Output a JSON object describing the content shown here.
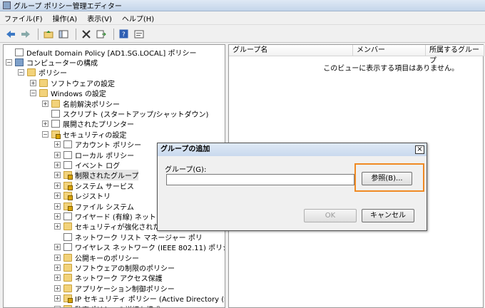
{
  "window": {
    "title": "グループ ポリシー管理エディター"
  },
  "menu": [
    "ファイル(F)",
    "操作(A)",
    "表示(V)",
    "ヘルプ(H)"
  ],
  "tree": [
    {
      "label": "Default Domain Policy [AD1.SG.LOCAL] ポリシー",
      "icon": "doc",
      "level": 0,
      "exp": ""
    },
    {
      "label": "コンピューターの構成",
      "icon": "pc",
      "level": 0,
      "exp": "−"
    },
    {
      "label": "ポリシー",
      "icon": "folder",
      "level": 1,
      "exp": "−"
    },
    {
      "label": "ソフトウェアの設定",
      "icon": "folder",
      "level": 2,
      "exp": "+"
    },
    {
      "label": "Windows の設定",
      "icon": "folder",
      "level": 2,
      "exp": "−"
    },
    {
      "label": "名前解決ポリシー",
      "icon": "folder",
      "level": 3,
      "exp": "+"
    },
    {
      "label": "スクリプト (スタートアップ/シャットダウン)",
      "icon": "doc",
      "level": 3,
      "exp": ""
    },
    {
      "label": "展開されたプリンター",
      "icon": "doc",
      "level": 3,
      "exp": "+"
    },
    {
      "label": "セキュリティの設定",
      "icon": "lock",
      "level": 3,
      "exp": "−"
    },
    {
      "label": "アカウント ポリシー",
      "icon": "doc",
      "level": 4,
      "exp": "+"
    },
    {
      "label": "ローカル ポリシー",
      "icon": "doc",
      "level": 4,
      "exp": "+"
    },
    {
      "label": "イベント ログ",
      "icon": "doc",
      "level": 4,
      "exp": "+"
    },
    {
      "label": "制限されたグループ",
      "icon": "lock",
      "level": 4,
      "exp": "+",
      "selected": true
    },
    {
      "label": "システム サービス",
      "icon": "lock",
      "level": 4,
      "exp": "+"
    },
    {
      "label": "レジストリ",
      "icon": "lock",
      "level": 4,
      "exp": "+"
    },
    {
      "label": "ファイル システム",
      "icon": "lock",
      "level": 4,
      "exp": "+"
    },
    {
      "label": "ワイヤード (有線) ネットワーク",
      "icon": "doc",
      "level": 4,
      "exp": "+"
    },
    {
      "label": "セキュリティが強化された W",
      "icon": "folder",
      "level": 4,
      "exp": "+"
    },
    {
      "label": "ネットワーク リスト マネージャー ポリ",
      "icon": "doc",
      "level": 4,
      "exp": ""
    },
    {
      "label": "ワイヤレス ネットワーク (IEEE 802.11) ポリシー",
      "icon": "doc",
      "level": 4,
      "exp": "+"
    },
    {
      "label": "公開キーのポリシー",
      "icon": "folder",
      "level": 4,
      "exp": "+"
    },
    {
      "label": "ソフトウェアの制限のポリシー",
      "icon": "folder",
      "level": 4,
      "exp": "+"
    },
    {
      "label": "ネットワーク アクセス保護",
      "icon": "folder",
      "level": 4,
      "exp": "+"
    },
    {
      "label": "アプリケーション制御ポリシー",
      "icon": "folder",
      "level": 4,
      "exp": "+"
    },
    {
      "label": "IP セキュリティ ポリシー (Active Directory (SC",
      "icon": "lock",
      "level": 4,
      "exp": "+"
    },
    {
      "label": "監査ポリシーの詳細な構成",
      "icon": "folder",
      "level": 4,
      "exp": "+"
    }
  ],
  "list": {
    "columns": [
      "グループ名",
      "メンバー",
      "所属するグループ"
    ],
    "empty_message": "このビューに表示する項目はありません。"
  },
  "dialog": {
    "title": "グループの追加",
    "group_label": "グループ(G):",
    "group_value": "",
    "browse_label": "参照(B)...",
    "ok_label": "OK",
    "cancel_label": "キャンセル",
    "close_glyph": "×"
  },
  "colors": {
    "highlight": "#f08a24"
  }
}
